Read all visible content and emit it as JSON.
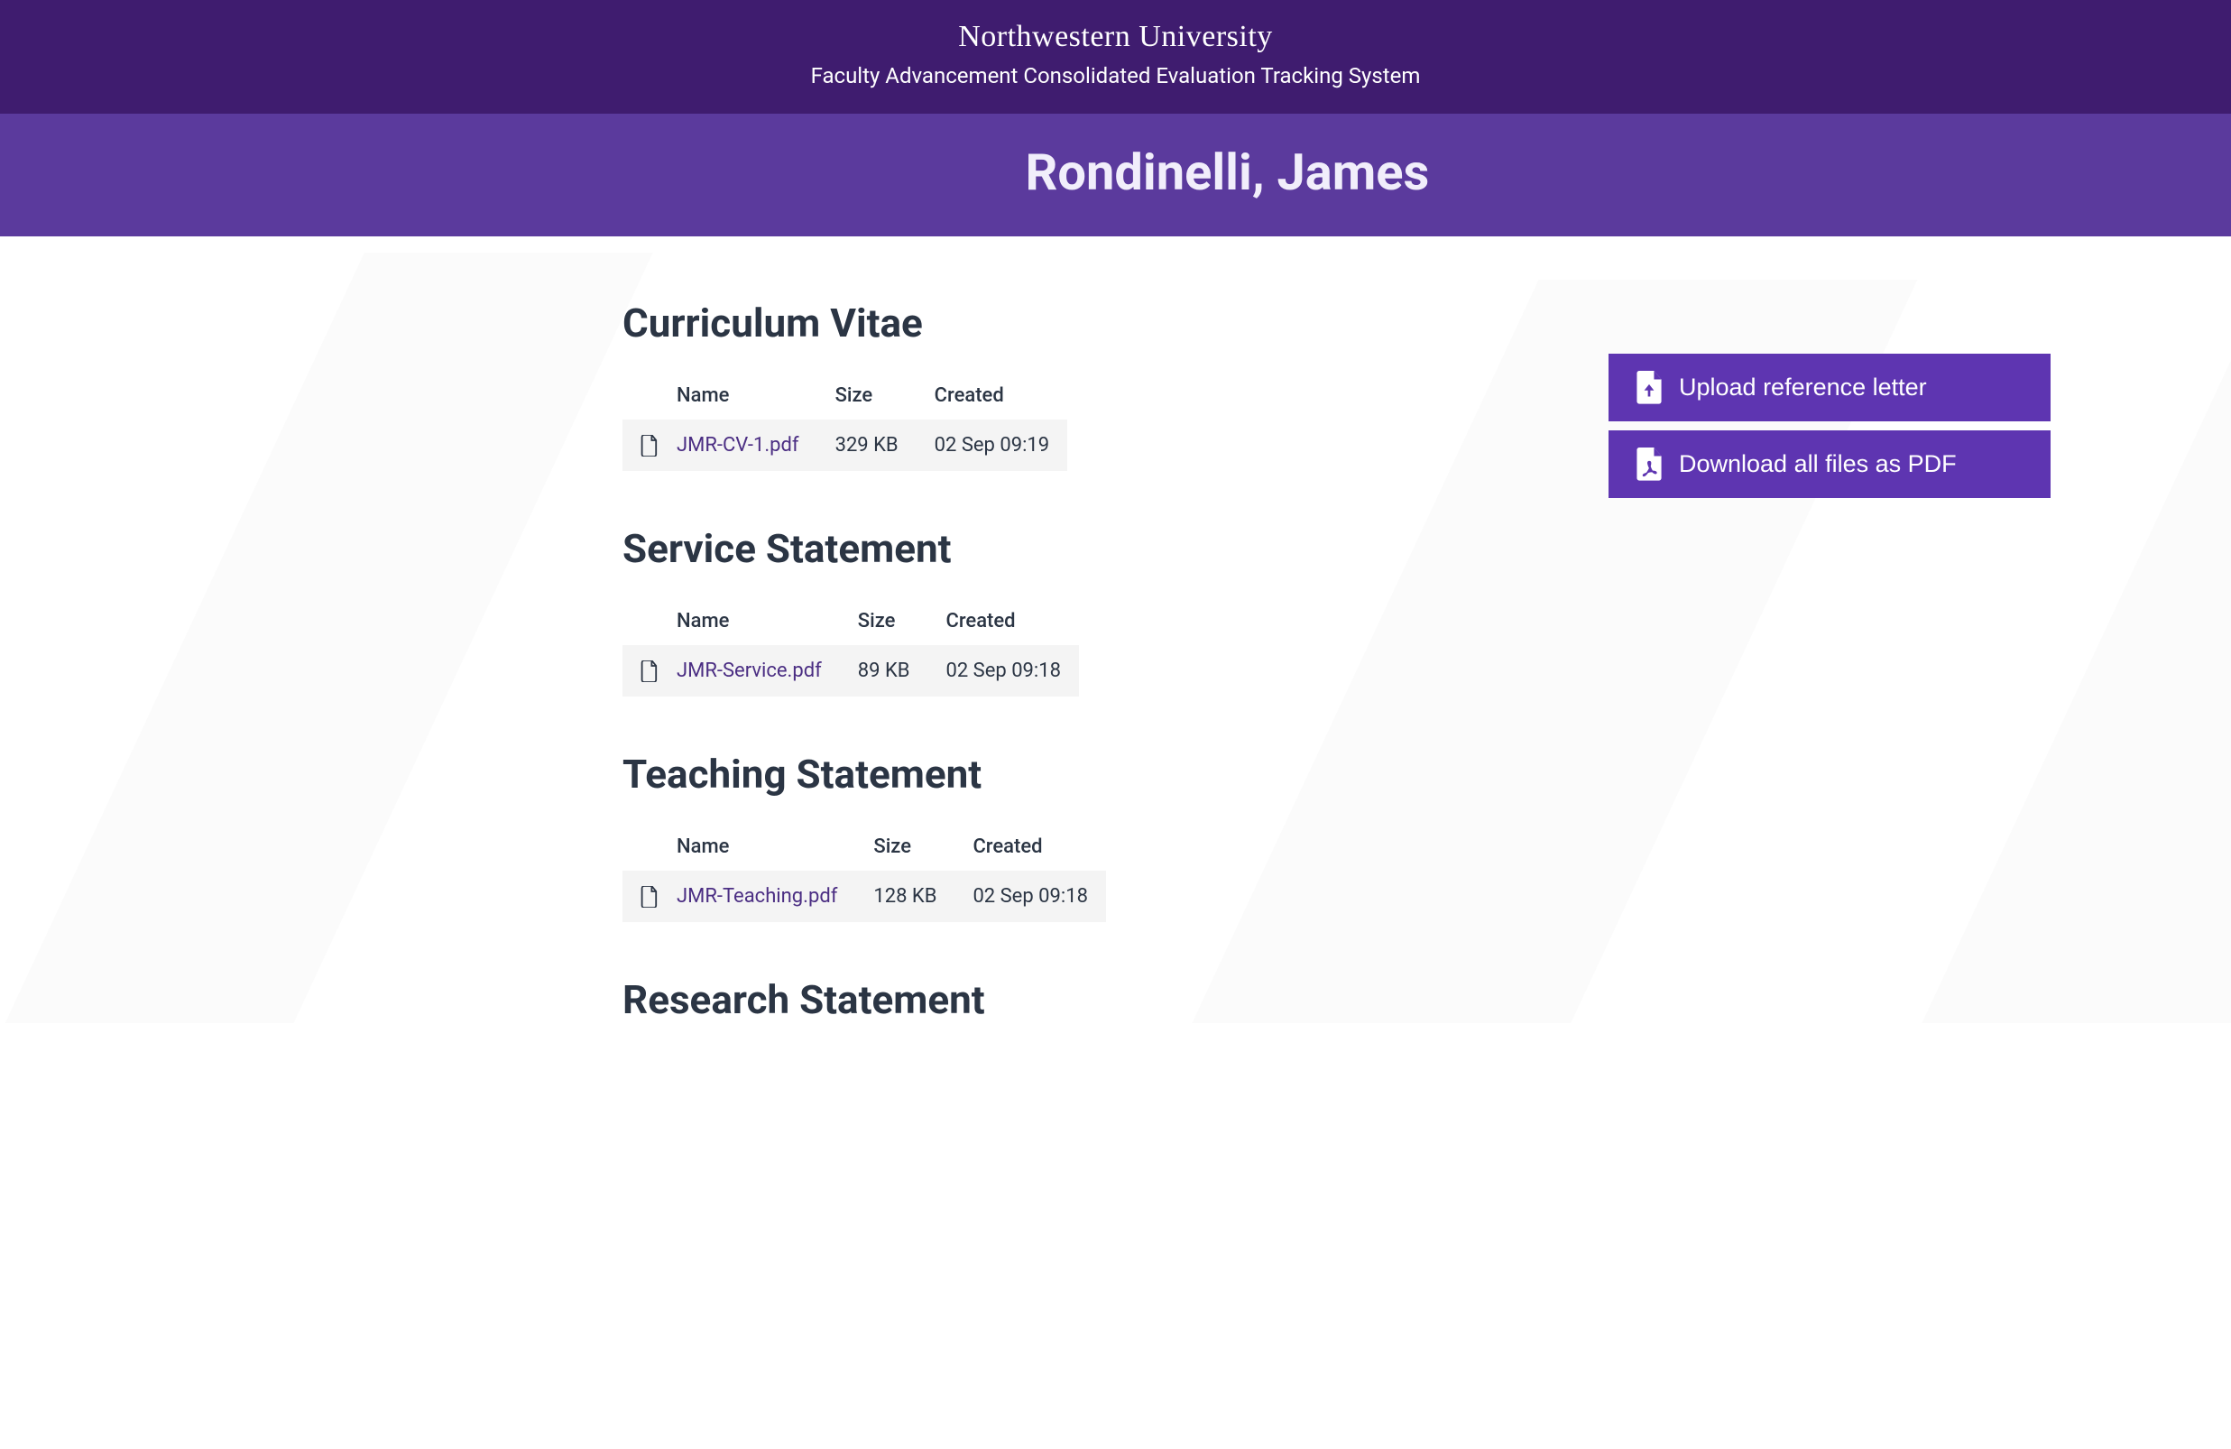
{
  "header": {
    "university": "Northwestern University",
    "subtitle": "Faculty Advancement Consolidated Evaluation Tracking System"
  },
  "person_name": "Rondinelli, James",
  "actions": {
    "upload_label": "Upload reference letter",
    "download_label": "Download all files as PDF"
  },
  "table_headers": {
    "name": "Name",
    "size": "Size",
    "created": "Created"
  },
  "sections": [
    {
      "title": "Curriculum Vitae",
      "files": [
        {
          "name": "JMR-CV-1.pdf",
          "size": "329 KB",
          "created": "02 Sep 09:19"
        }
      ]
    },
    {
      "title": "Service Statement",
      "files": [
        {
          "name": "JMR-Service.pdf",
          "size": "89 KB",
          "created": "02 Sep 09:18"
        }
      ]
    },
    {
      "title": "Teaching Statement",
      "files": [
        {
          "name": "JMR-Teaching.pdf",
          "size": "128 KB",
          "created": "02 Sep 09:18"
        }
      ]
    },
    {
      "title": "Research Statement",
      "files": []
    }
  ]
}
